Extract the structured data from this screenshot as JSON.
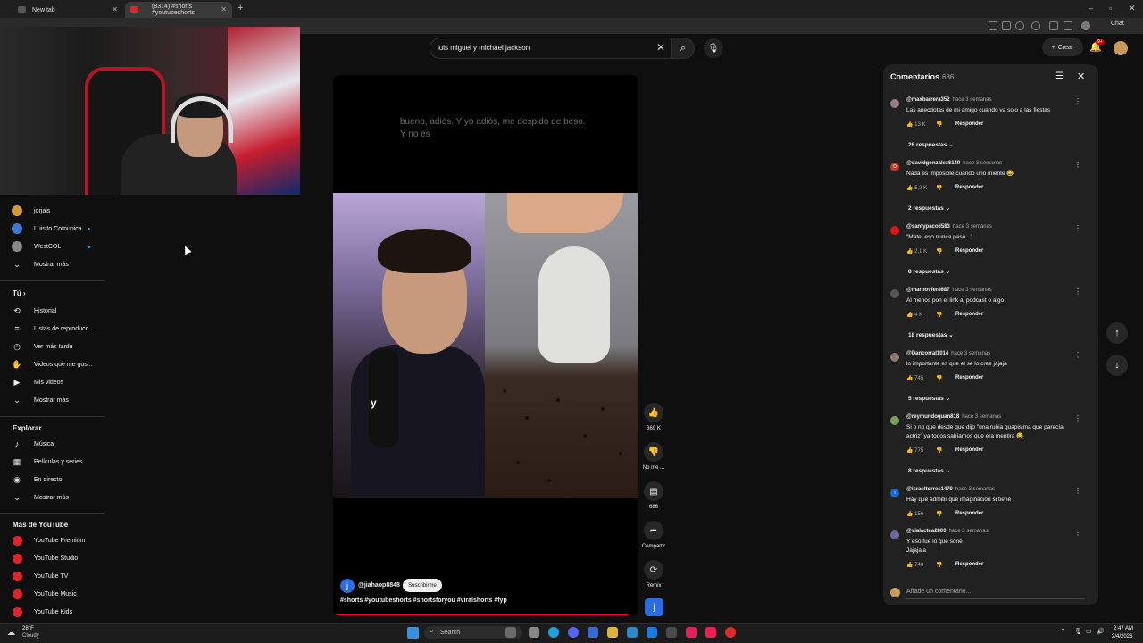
{
  "browser": {
    "tabs": [
      {
        "title": "New tab"
      },
      {
        "title": "(8314) #shorts #youtubeshorts"
      }
    ],
    "chat_label": "Chat"
  },
  "search": {
    "query": "luis miguel y michael jackson"
  },
  "header": {
    "create_label": "Crear",
    "notification_count": "9+"
  },
  "sidebar": {
    "subscriptions": [
      {
        "label": "jorjais",
        "color": "#d49a3a"
      },
      {
        "label": "Luisito Comunica",
        "color": "#3a7ad4",
        "dot": true
      },
      {
        "label": "WestCOL",
        "color": "#888888",
        "dot": true
      }
    ],
    "show_more_1": "Mostrar más",
    "you_heading": "Tú",
    "you_items": [
      {
        "label": "Historial",
        "icon": "history-icon",
        "glyph": "⟲"
      },
      {
        "label": "Listas de reproducc...",
        "icon": "playlist-icon",
        "glyph": "≡"
      },
      {
        "label": "Ver más tarde",
        "icon": "clock-icon",
        "glyph": "◷"
      },
      {
        "label": "Videos que me gus...",
        "icon": "thumbs-up-icon",
        "glyph": "👍"
      },
      {
        "label": "Mis videos",
        "icon": "video-icon",
        "glyph": "▶"
      }
    ],
    "show_more_2": "Mostrar más",
    "explore_heading": "Explorar",
    "explore_items": [
      {
        "label": "Música",
        "icon": "music-icon",
        "glyph": "♪"
      },
      {
        "label": "Películas y series",
        "icon": "film-icon",
        "glyph": "▦"
      },
      {
        "label": "En directo",
        "icon": "live-icon",
        "glyph": "◉"
      }
    ],
    "show_more_3": "Mostrar más",
    "more_heading": "Más de YouTube",
    "more_items": [
      {
        "label": "YouTube Premium"
      },
      {
        "label": "YouTube Studio"
      },
      {
        "label": "YouTube TV"
      },
      {
        "label": "YouTube Music"
      },
      {
        "label": "YouTube Kids"
      }
    ]
  },
  "short": {
    "caption": "bueno, adiós. Y yo adiós, me despido de beso. Y no es",
    "overlay_word": "y",
    "channel_initial": "j",
    "channel_handle": "@jiahaop8848",
    "subscribe_label": "Suscribirme",
    "hashtags": "#shorts #youtubeshorts #shortsforyou #viralshorts #fyp",
    "progress": 0.98
  },
  "actions": {
    "likes": "369 K",
    "dislike_label": "No me ...",
    "comments": "686",
    "share_label": "Compartir",
    "remix_label": "Remix"
  },
  "comments": {
    "title": "Comentarios",
    "count": "686",
    "items": [
      {
        "author": "@maxbarrera352",
        "time": "hace 3 semanas",
        "text": "Las anecdotas de mi amigo cuando va solo a las fiestas",
        "likes": "13 K",
        "reply_label": "Responder",
        "replies": "28 respuestas",
        "avatar_color": "#9a7a8a",
        "initial": ""
      },
      {
        "author": "@davidgonzalez6149",
        "time": "hace 3 semanas",
        "text": "Nada es imposible cuando uno miente 😂",
        "likes": "5,2 K",
        "reply_label": "Responder",
        "replies": "2 respuestas",
        "avatar_color": "#c0392b",
        "initial": "D"
      },
      {
        "author": "@santypaco6583",
        "time": "hace 3 semanas",
        "text": "\"Mate, eso nunca paso...\"",
        "likes": "2,1 K",
        "reply_label": "Responder",
        "replies": "8 respuestas",
        "avatar_color": "#e31212",
        "initial": ""
      },
      {
        "author": "@marnovfer8687",
        "time": "hace 3 semanas",
        "text": "Al menos pon el link al podcast o algo",
        "likes": "4 K",
        "reply_label": "Responder",
        "replies": "18 respuestas",
        "avatar_color": "#555555",
        "initial": ""
      },
      {
        "author": "@Dancorral1014",
        "time": "hace 3 semanas",
        "text": "lo importante es que el se lo cree jajaja",
        "likes": "745",
        "reply_label": "Responder",
        "replies": "5 respuestas",
        "avatar_color": "#8a7a6a",
        "initial": ""
      },
      {
        "author": "@reymundoquan818",
        "time": "hace 3 semanas",
        "text": "Si o no que desde que dijo \"una rubia guapisima que parecía actriz\" ya todos sabíamos que era mentira 😂",
        "likes": "775",
        "reply_label": "Responder",
        "replies": "8 respuestas",
        "avatar_color": "#7aa05a",
        "initial": ""
      },
      {
        "author": "@israeltorres1470",
        "time": "hace 3 semanas",
        "text": "Hay que admitir que imaginación si tiene",
        "likes": "156",
        "reply_label": "Responder",
        "replies": "",
        "avatar_color": "#1a6ad4",
        "initial": "i"
      },
      {
        "author": "@vialactea2800",
        "time": "hace 3 semanas",
        "text": "Y eso fue lo que soñé\nJajajaja",
        "likes": "740",
        "reply_label": "Responder",
        "replies": "",
        "avatar_color": "#6a6a9a",
        "initial": ""
      }
    ],
    "add_placeholder": "Añade un comentario..."
  },
  "taskbar": {
    "temperature": "28°F",
    "condition": "Cloudy",
    "search_label": "Search",
    "time": "2:47 AM",
    "date": "2/4/2026"
  }
}
